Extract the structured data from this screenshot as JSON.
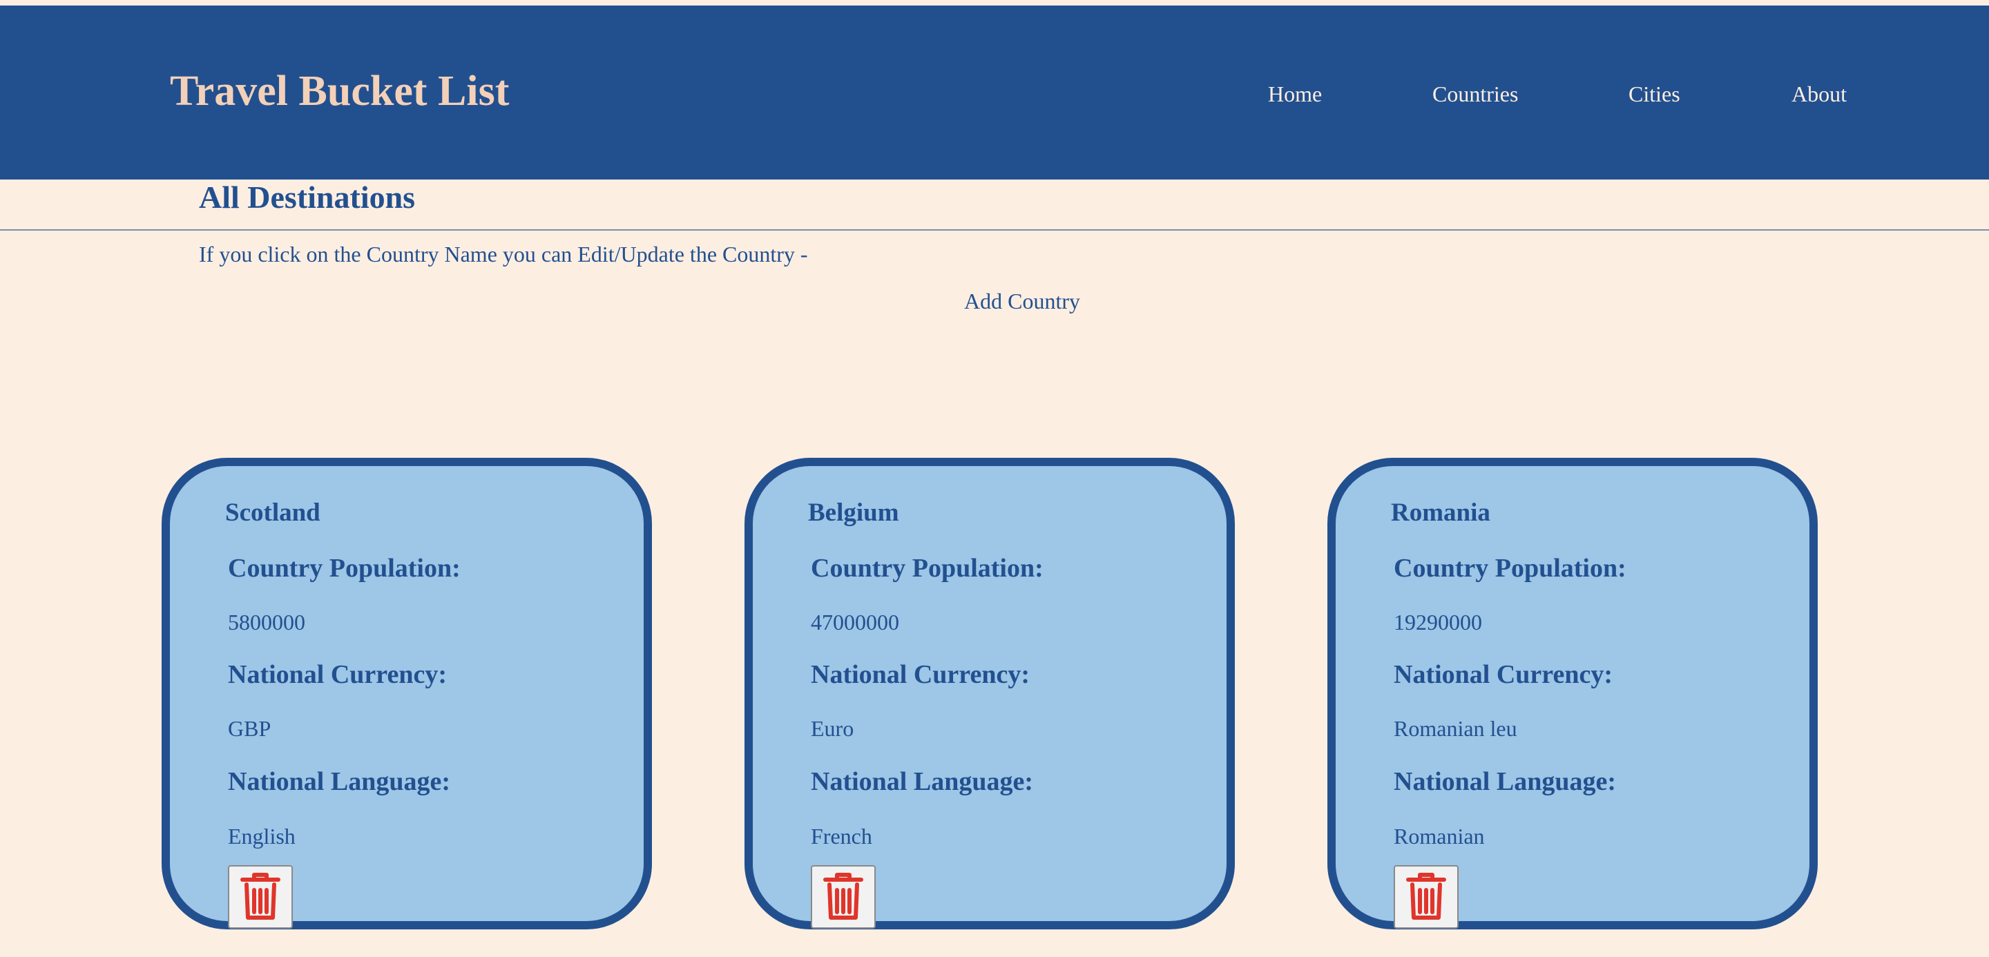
{
  "header": {
    "title": "Travel Bucket List",
    "nav": [
      "Home",
      "Countries",
      "Cities",
      "About"
    ]
  },
  "main": {
    "heading": "All Destinations",
    "instructions": "If you click on the Country Name you can Edit/Update the Country -",
    "add_country": "Add Country"
  },
  "labels": {
    "population": "Country Population:",
    "currency": "National Currency:",
    "language": "National Language:"
  },
  "countries": [
    {
      "name": "Scotland",
      "population": "5800000",
      "currency": "GBP",
      "language": "English"
    },
    {
      "name": "Belgium",
      "population": "47000000",
      "currency": "Euro",
      "language": "French"
    },
    {
      "name": "Romania",
      "population": "19290000",
      "currency": "Romanian leu",
      "language": "Romanian"
    }
  ],
  "icons": {
    "delete": "trash-icon"
  },
  "colors": {
    "primary": "#22508f",
    "background": "#fdeee2",
    "card": "#9dc6e7",
    "brand": "#f3d0b8",
    "danger": "#e0352b"
  }
}
